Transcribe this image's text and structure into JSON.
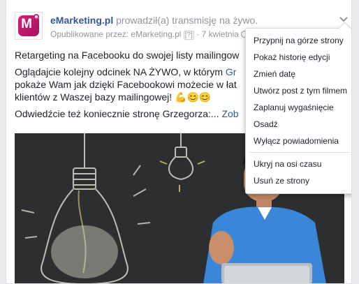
{
  "post": {
    "avatar_letter": "M",
    "page_name": "eMarketing.pl",
    "action_text": " prowadził(a) transmisję na żywo.",
    "published_by": "Opublikowane przez: eMarketing.pl",
    "help": "[?]",
    "date": " · 7 kwietnia"
  },
  "body": {
    "line1": "Retargeting na Facebooku do swojej listy mailingow",
    "line2_start": "Oglądajcie kolejny odcinek NA ŻYWO, w którym ",
    "line2_link": "Gr",
    "line3": "pokaże Wam jak dzięki Facebookowi możecie w łat",
    "line4": "klientów z Waszej bazy mailingowej! 💪😊😊",
    "line5_start": "Odwiedźcie też koniecznie stronę Grzegorza:... ",
    "line5_link": "Zob"
  },
  "menu": {
    "items": [
      "Przypnij na górze strony",
      "Pokaż historię edycji",
      "Zmień datę",
      "Utwórz post z tym filmem",
      "Zaplanuj wygaśnięcie",
      "Osadź",
      "Wyłącz powiadomienia"
    ],
    "items2": [
      "Ukryj na osi czasu",
      "Usuń ze strony"
    ]
  },
  "colors": {
    "link": "#365899",
    "brand": "#d4207a"
  },
  "icons": {
    "chevron": "chevron-down-icon",
    "globe": "globe-icon"
  }
}
